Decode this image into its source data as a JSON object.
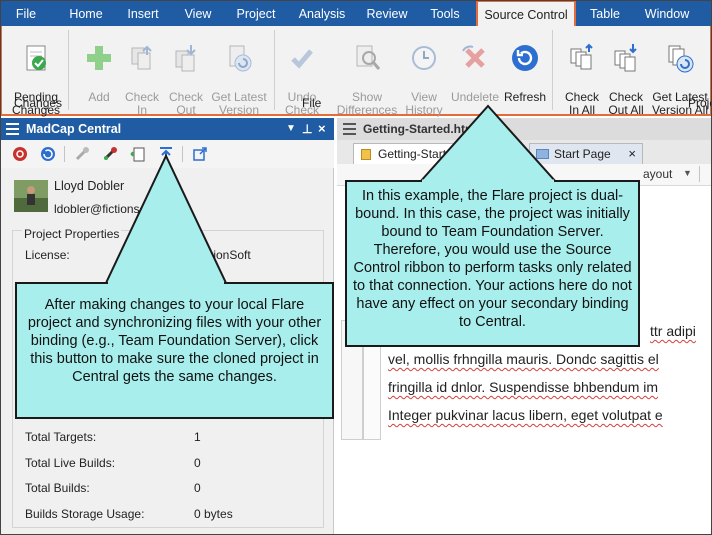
{
  "menu": {
    "tabs": [
      "File",
      "Home",
      "Insert",
      "View",
      "Project",
      "Analysis",
      "Review",
      "Tools",
      "Source Control",
      "Table",
      "Window"
    ],
    "active": "Source Control"
  },
  "ribbon": {
    "pending_changes": "Pending\nChanges",
    "add": "Add",
    "check_in": "Check\nIn",
    "check_out": "Check\nOut",
    "get_latest_version": "Get Latest\nVersion",
    "undo_check_out": "Undo\nCheck Out",
    "show_differences": "Show\nDifferences",
    "view_history": "View\nHistory",
    "undelete": "Undelete",
    "refresh": "Refresh",
    "check_in_all": "Check\nIn All",
    "check_out_all": "Check\nOut All",
    "get_latest_version_all": "Get Latest\nVersion All",
    "group_changes": "Changes",
    "group_file": "File",
    "group_project_partial": "Proje"
  },
  "panel": {
    "title": "MadCap Central",
    "user_name": "Lloyd Dobler",
    "user_email": "ldobler@fictionsc",
    "project_properties": "Project Properties",
    "license_label": "License:",
    "license_value": "FictionSoft",
    "total_targets_label": "Total Targets:",
    "total_targets_value": "1",
    "total_live_builds_label": "Total Live Builds:",
    "total_live_builds_value": "0",
    "total_builds_label": "Total Builds:",
    "total_builds_value": "0",
    "storage_label": "Builds Storage Usage:",
    "storage_value": "0 bytes"
  },
  "editor": {
    "doc_title": "Getting-Started.htm",
    "tab_active": "Getting-Started",
    "tab_start": "Start Page",
    "toolbar_partial": "ayout",
    "lines": [
      "ttr adipi",
      "vel, mollis frhngilla mauris. Dondc sagittis el",
      "fringilla id dnlor. Suspendisse bhbendum im",
      "Integer pukvinar lacus libern, eget volutpat e"
    ]
  },
  "callouts": {
    "left": "After making changes to your local Flare project and synchronizing files with your other binding (e.g., Team Foundation Server), click this button to make sure the cloned project in Central gets the same changes.",
    "right": "In this example, the Flare project is dual-bound. In this case, the project was initially bound to Team Foundation Server. Therefore, you would use the Source Control ribbon to perform tasks only related to that connection. Your actions here do not have any effect on your secondary binding to Central."
  },
  "colors": {
    "menu_bar": "#1f5ca3",
    "active_tab_border": "#e46c3a",
    "callout_fill": "#a8eeec"
  }
}
